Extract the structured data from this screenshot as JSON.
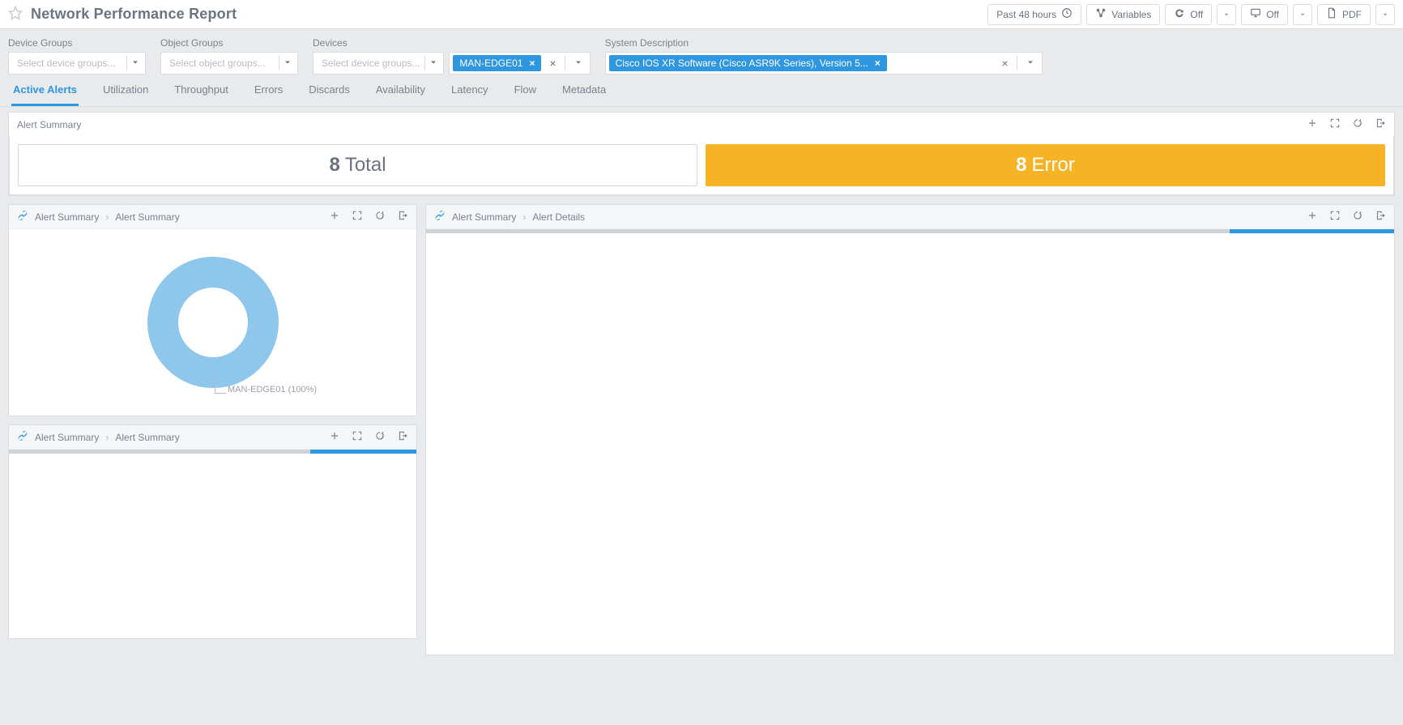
{
  "header": {
    "title": "Network Performance Report",
    "time_range": "Past 48 hours",
    "variables_label": "Variables",
    "refresh_off": "Off",
    "display_off": "Off",
    "pdf_label": "PDF"
  },
  "filters": {
    "device_groups": {
      "label": "Device Groups",
      "placeholder": "Select device groups..."
    },
    "object_groups": {
      "label": "Object Groups",
      "placeholder": "Select object groups..."
    },
    "devices": {
      "label": "Devices",
      "placeholder": "Select device groups...",
      "chips": [
        "MAN-EDGE01"
      ]
    },
    "system_description": {
      "label": "System Description",
      "chips": [
        "Cisco IOS XR Software (Cisco ASR9K Series), Version 5..."
      ]
    }
  },
  "tabs": [
    "Active Alerts",
    "Utilization",
    "Throughput",
    "Errors",
    "Discards",
    "Availability",
    "Latency",
    "Flow",
    "Metadata"
  ],
  "active_tab": "Active Alerts",
  "alert_summary": {
    "title": "Alert Summary",
    "total": {
      "count": "8",
      "label": "Total"
    },
    "error": {
      "count": "8",
      "label": "Error"
    }
  },
  "panel_left_1": {
    "crumb1": "Alert Summary",
    "crumb2": "Alert Summary"
  },
  "panel_left_2": {
    "crumb1": "Alert Summary",
    "crumb2": "Alert Summary"
  },
  "panel_right": {
    "crumb1": "Alert Summary",
    "crumb2": "Alert Details"
  },
  "chart_data": {
    "type": "pie",
    "title": "Alert Summary",
    "series": [
      {
        "name": "MAN-EDGE01",
        "value": 100,
        "label": "MAN-EDGE01 (100%)",
        "color": "#8fc7ec"
      }
    ]
  }
}
